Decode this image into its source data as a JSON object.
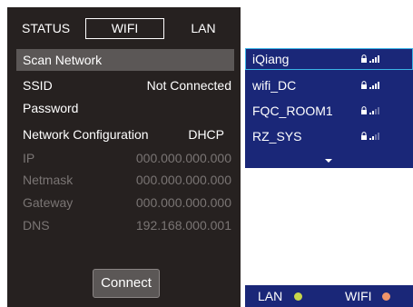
{
  "tabs": {
    "status": "STATUS",
    "wifi": "WIFI",
    "lan": "LAN",
    "active": "wifi"
  },
  "scan_network_label": "Scan Network",
  "fields": {
    "ssid": {
      "label": "SSID",
      "value": "Not Connected"
    },
    "password": {
      "label": "Password",
      "value": ""
    },
    "network_config": {
      "label": "Network Configuration",
      "value": "DHCP"
    },
    "ip": {
      "label": "IP",
      "value": "000.000.000.000"
    },
    "netmask": {
      "label": "Netmask",
      "value": "000.000.000.000"
    },
    "gateway": {
      "label": "Gateway",
      "value": "000.000.000.000"
    },
    "dns": {
      "label": "DNS",
      "value": "192.168.000.001"
    }
  },
  "connect_label": "Connect",
  "networks": [
    {
      "name": "iQiang",
      "locked": true,
      "signal_bars": 4,
      "selected": true
    },
    {
      "name": "wifi_DC",
      "locked": true,
      "signal_bars": 4,
      "selected": false
    },
    {
      "name": "FQC_ROOM1",
      "locked": true,
      "signal_bars": 2,
      "selected": false
    },
    {
      "name": "RZ_SYS",
      "locked": true,
      "signal_bars": 2,
      "selected": false
    }
  ],
  "status_bar": {
    "lan_label": "LAN",
    "lan_color": "#c8d64a",
    "wifi_label": "WIFI",
    "wifi_color": "#f0956a"
  },
  "colors": {
    "panel_bg": "#262120",
    "highlight_row": "#5b5756",
    "list_bg": "#1a2778",
    "selected_border": "#3cb4e6",
    "dim_text": "#7a7574"
  },
  "icons": {
    "lock": "lock-icon",
    "signal": "wifi-signal-icon",
    "more": "chevron-down-icon"
  }
}
